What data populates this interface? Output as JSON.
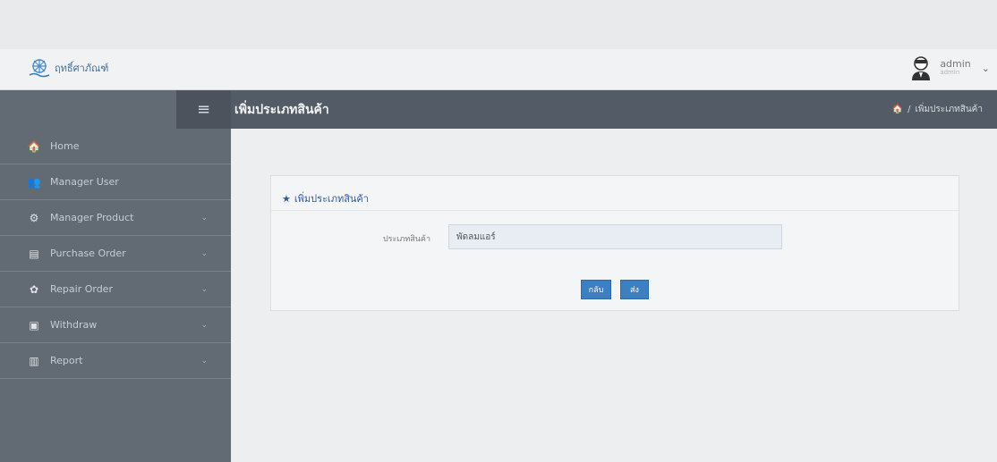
{
  "header": {
    "logo_text": "ฤทธิ์ศาภัณฑ์",
    "user": {
      "name": "admin",
      "role": "admin",
      "caret": "⌄"
    }
  },
  "sidebar": {
    "toggle_icon": "≡",
    "items": [
      {
        "label": "Home",
        "icon": "home-icon",
        "glyph": "🏠",
        "caret": ""
      },
      {
        "label": "Manager User",
        "icon": "users-icon",
        "glyph": "👥",
        "caret": ""
      },
      {
        "label": "Manager Product",
        "icon": "cubes-icon",
        "glyph": "⚙",
        "caret": "⌄"
      },
      {
        "label": "Purchase Order",
        "icon": "credit-card-icon",
        "glyph": "▤",
        "caret": "⌄"
      },
      {
        "label": "Repair Order",
        "icon": "cog-icon",
        "glyph": "✿",
        "caret": "⌄"
      },
      {
        "label": "Withdraw",
        "icon": "file-icon",
        "glyph": "▣",
        "caret": "⌄"
      },
      {
        "label": "Report",
        "icon": "columns-icon",
        "glyph": "▥",
        "caret": "⌄"
      }
    ]
  },
  "page": {
    "title": "เพิ่มประเภทสินค้า",
    "breadcrumb": {
      "home_glyph": "🏠",
      "separator": "/",
      "current": "เพิ่มประเภทสินค้า"
    }
  },
  "form": {
    "heading": "เพิ่มประเภทสินค้า",
    "star_glyph": "★",
    "field_label": "ประเภทสินค้า",
    "field_value": "พัดลมแอร์",
    "back_label": "กลับ",
    "submit_label": "ส่ง"
  },
  "colors": {
    "sidebar": "#626a74",
    "header": "#535b66",
    "accent": "#3c7fc3"
  }
}
